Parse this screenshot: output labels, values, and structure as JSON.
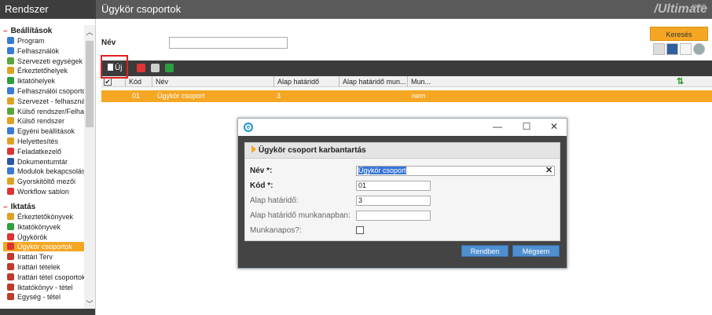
{
  "app": {
    "name": "Rendszer",
    "page_title": "Ügykör csoportok",
    "brand": "Ultimate",
    "brand_small": "SMAR"
  },
  "sidebar": {
    "groups": [
      {
        "title": "Beállítások",
        "items": [
          {
            "label": "Program",
            "icon": "program-icon",
            "color": "#3a7bd5"
          },
          {
            "label": "Felhasználók",
            "icon": "user-icon",
            "color": "#3a7bd5"
          },
          {
            "label": "Szervezeti egységek",
            "icon": "org-icon",
            "color": "#5aa63a"
          },
          {
            "label": "Érkeztetőhelyek",
            "icon": "inbox-icon",
            "color": "#e0a020"
          },
          {
            "label": "Iktatóhelyek",
            "icon": "register-icon",
            "color": "#2e9e3e"
          },
          {
            "label": "Felhasználói csoportok",
            "icon": "usergroup-icon",
            "color": "#3a7bd5"
          },
          {
            "label": "Szervezet - felhasználó",
            "icon": "org-user-icon",
            "color": "#e0a020"
          },
          {
            "label": "Külső rendszer/Felhasz",
            "icon": "external-user-icon",
            "color": "#5aa63a"
          },
          {
            "label": "Külső rendszer",
            "icon": "external-icon",
            "color": "#e0a020"
          },
          {
            "label": "Egyéni beállítások",
            "icon": "custom-settings-icon",
            "color": "#3a7bd5"
          },
          {
            "label": "Helyettesítés",
            "icon": "substitute-icon",
            "color": "#e0a020"
          },
          {
            "label": "Feladatkezelő",
            "icon": "task-icon",
            "color": "#d33"
          },
          {
            "label": "Dokumentumtár",
            "icon": "word-icon",
            "color": "#2a57a8"
          },
          {
            "label": "Modulok bekapcsolása",
            "icon": "module-icon",
            "color": "#3a7bd5"
          },
          {
            "label": "Gyorskitöltő mezői",
            "icon": "quickfill-icon",
            "color": "#e0a020"
          },
          {
            "label": "Workflow sablon",
            "icon": "workflow-icon",
            "color": "#d33"
          }
        ]
      },
      {
        "title": "Iktatás",
        "items": [
          {
            "label": "Érkeztetőkönyvek",
            "icon": "inbox-book-icon",
            "color": "#e0a020"
          },
          {
            "label": "Iktatókönyvek",
            "icon": "register-book-icon",
            "color": "#2e9e3e"
          },
          {
            "label": "Ügykörök",
            "icon": "case-icon",
            "color": "#d33"
          },
          {
            "label": "Ügykör csoportok",
            "icon": "case-group-icon",
            "color": "#d33",
            "active": true
          },
          {
            "label": "Irattári Terv",
            "icon": "archive-plan-icon",
            "color": "#c0392b"
          },
          {
            "label": "Irattári tételek",
            "icon": "archive-items-icon",
            "color": "#c0392b"
          },
          {
            "label": "Irattári tétel csoportok",
            "icon": "archive-group-icon",
            "color": "#c0392b"
          },
          {
            "label": "Iktatókönyv - tétel",
            "icon": "book-item-icon",
            "color": "#c0392b"
          },
          {
            "label": "Egység - tétel",
            "icon": "unit-item-icon",
            "color": "#c0392b"
          }
        ]
      }
    ]
  },
  "search": {
    "label": "Név",
    "value": "",
    "button": "Keresés"
  },
  "toolbar": {
    "new_label": "Új"
  },
  "grid": {
    "columns": [
      "Kód",
      "Név",
      "Alap határidő",
      "Alap határidő mun...",
      "Mun..."
    ],
    "rows": [
      {
        "kod": "01",
        "nev": "Ügykör csoport",
        "hatarido": "3",
        "hatarido_mun": "",
        "mun": "nem"
      }
    ]
  },
  "modal": {
    "title": "Ügykör csoport karbantartás",
    "fields": {
      "nev_label": "Név *:",
      "nev_value": "Ügykör csoport",
      "kod_label": "Kód *:",
      "kod_value": "01",
      "hatarido_label": "Alap határidő:",
      "hatarido_value": "3",
      "munkanap_label": "Alap határidő munkanapban:",
      "munkanap_value": "",
      "munkanapos_label": "Munkanapos?:"
    },
    "ok_button": "Rendben",
    "cancel_button": "Mégsem"
  },
  "colors": {
    "accent": "#f5a623",
    "dark": "#3b3b3b",
    "modal_button": "#4f8fd0"
  }
}
